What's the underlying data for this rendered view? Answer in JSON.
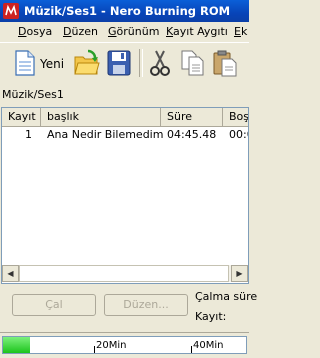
{
  "window": {
    "title": "Müzik/Ses1 - Nero Burning ROM"
  },
  "menu": {
    "items": [
      {
        "accel": "D",
        "rest": "osya"
      },
      {
        "accel": "D",
        "rest": "üzen"
      },
      {
        "accel": "G",
        "rest": "örünüm"
      },
      {
        "accel": "K",
        "rest": "ayıt Aygıtı"
      },
      {
        "accel": "E",
        "rest": "k"
      }
    ]
  },
  "toolbar": {
    "new_label": "Yeni",
    "icons": [
      "new-icon",
      "open-folder-icon",
      "save-icon",
      "cut-icon",
      "copy-icon",
      "paste-icon"
    ]
  },
  "path_label": "Müzik/Ses1",
  "track_list": {
    "columns": [
      "Kayıt",
      "başlık",
      "Süre",
      "Boş"
    ],
    "rows": [
      {
        "track": "1",
        "title": "Ana Nedir Bilemedim",
        "duration": "04:45.48",
        "pause": "00:0"
      }
    ]
  },
  "buttons": {
    "play": "Çal",
    "edit": "Düzen..."
  },
  "info": {
    "play_time_label": "Çalma süre",
    "track_label": "Kayıt:"
  },
  "status": {
    "marks": [
      "20Min",
      "40Min"
    ],
    "fill_fraction": 0.11,
    "fill_color": "#1cc41c"
  }
}
